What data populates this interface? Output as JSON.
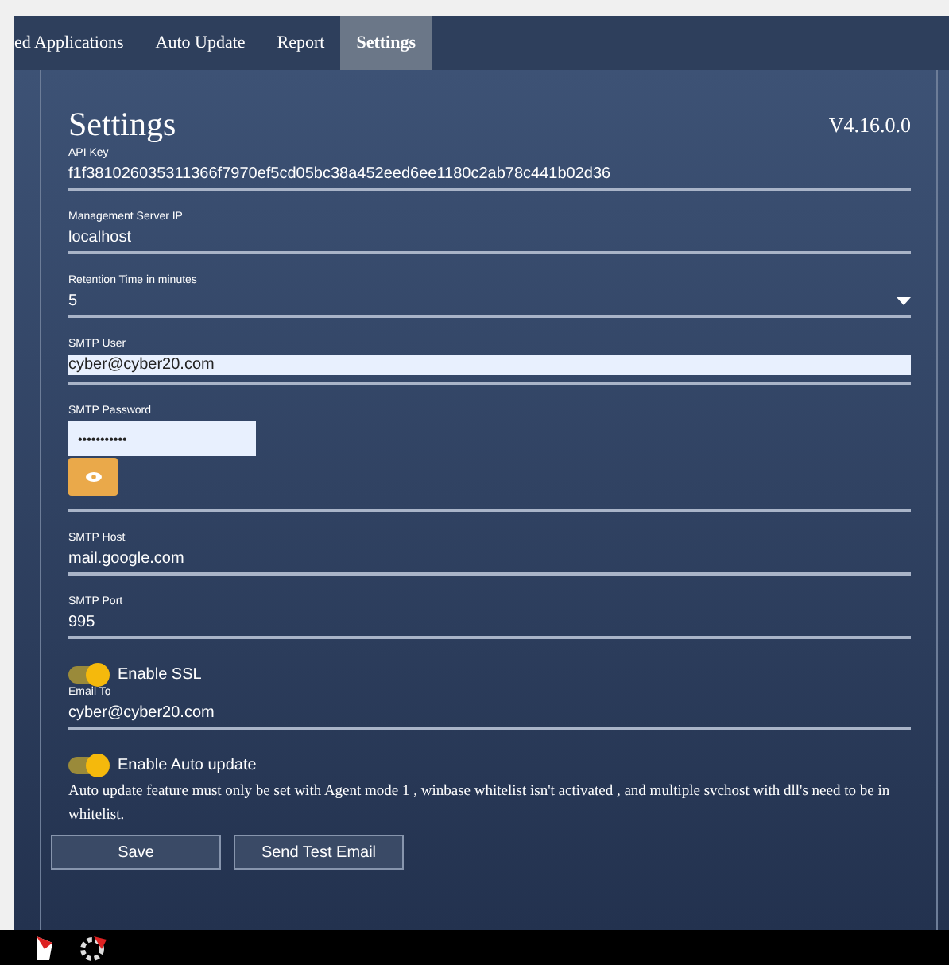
{
  "nav": {
    "tabs": [
      {
        "label": "ed Applications",
        "selected": false
      },
      {
        "label": "Auto Update",
        "selected": false
      },
      {
        "label": "Report",
        "selected": false
      },
      {
        "label": "Settings",
        "selected": true
      }
    ]
  },
  "settings": {
    "title": "Settings",
    "version": "V4.16.0.0",
    "items": [
      {
        "kind": "field",
        "label": "API Key",
        "value": "f1f381026035311366f7970ef5cd05bc38a452eed6ee1180c2ab78c441b02d36"
      },
      {
        "kind": "field",
        "label": "Management Server IP",
        "value": "localhost"
      },
      {
        "kind": "select",
        "label": "Retention Time in minutes",
        "value": "5"
      },
      {
        "kind": "autofill",
        "label": "SMTP User",
        "value": "cyber@cyber20.com"
      },
      {
        "kind": "password",
        "label": "SMTP Password",
        "value": "•••••••••••"
      },
      {
        "kind": "field",
        "label": "SMTP Host",
        "value": "mail.google.com"
      },
      {
        "kind": "field",
        "label": "SMTP Port",
        "value": "995"
      },
      {
        "kind": "toggle",
        "label": "Enable SSL",
        "on": true
      },
      {
        "kind": "field",
        "label": "Email To",
        "value": "cyber@cyber20.com"
      },
      {
        "kind": "toggle",
        "label": "Enable Auto update",
        "on": true
      },
      {
        "kind": "note",
        "text": "Auto update feature must only be set with Agent mode 1 , winbase whitelist isn't activated , and multiple svchost with dll's need to be in whitelist."
      }
    ],
    "buttons": [
      "Save",
      "Send Test Email"
    ]
  }
}
